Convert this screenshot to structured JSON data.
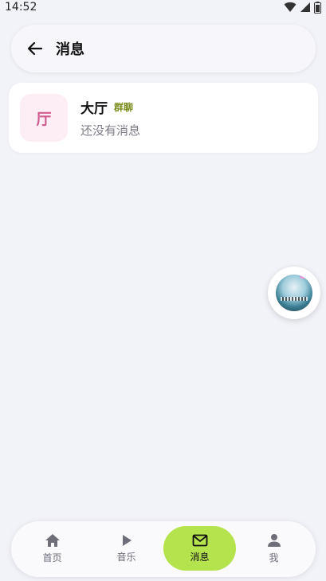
{
  "status_bar": {
    "time": "14:52"
  },
  "header": {
    "title": "消息"
  },
  "chats": [
    {
      "avatar_text": "厅",
      "name": "大厅",
      "tag": "群聊",
      "preview": "还没有消息"
    }
  ],
  "bottom_nav": [
    {
      "label": "首页",
      "icon": "home-icon"
    },
    {
      "label": "音乐",
      "icon": "play-icon"
    },
    {
      "label": "消息",
      "icon": "mail-icon",
      "active": true
    },
    {
      "label": "我",
      "icon": "person-icon"
    }
  ],
  "colors": {
    "accent": "#b5e34e",
    "avatar_bg": "#fdeef5",
    "avatar_text": "#d05c8f",
    "tag": "#7a8c1c",
    "background": "#f2f3f8"
  }
}
